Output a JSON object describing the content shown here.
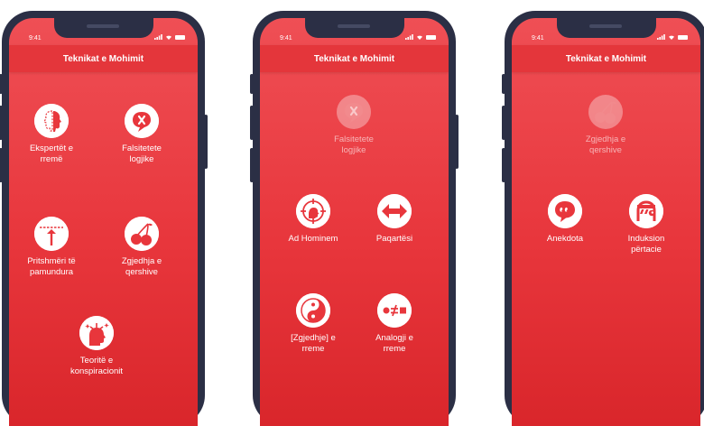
{
  "status_time": "9:41",
  "header_title": "Teknikat e Mohimit",
  "screens": [
    {
      "items": [
        {
          "lines": [
            "Ekspertët e",
            "rremë"
          ],
          "icon": "fake-experts-icon"
        },
        {
          "lines": [
            "Falsitetete",
            "logjike"
          ],
          "icon": "logical-fallacy-icon"
        },
        {
          "lines": [
            "Pritshmëri të",
            "pamundura"
          ],
          "icon": "impossible-expectations-icon"
        },
        {
          "lines": [
            "Zgjedhja e",
            "qershive"
          ],
          "icon": "cherry-picking-icon"
        },
        {
          "lines": [
            "Teoritë e",
            "konspiracionit"
          ],
          "icon": "conspiracy-icon"
        }
      ]
    },
    {
      "items": [
        {
          "lines": [
            "Falsitetete",
            "logjike"
          ],
          "icon": "logical-fallacy-icon",
          "selected": true
        },
        {
          "lines": [
            "Ad Hominem"
          ],
          "icon": "ad-hominem-icon"
        },
        {
          "lines": [
            "Paqartësi"
          ],
          "icon": "ambiguity-icon"
        },
        {
          "lines": [
            "[Zgjedhje] e",
            "rreme"
          ],
          "icon": "yin-yang-icon"
        },
        {
          "lines": [
            "Analogji e",
            "rreme"
          ],
          "icon": "false-analogy-icon"
        }
      ]
    },
    {
      "items": [
        {
          "lines": [
            "Zgjedhja e",
            "qershive"
          ],
          "icon": "cherry-picking-icon",
          "selected": true
        },
        {
          "lines": [
            "Anekdota"
          ],
          "icon": "anecdote-icon"
        },
        {
          "lines": [
            "Induksion",
            "përtacie"
          ],
          "icon": "slothful-induction-icon"
        }
      ]
    }
  ]
}
